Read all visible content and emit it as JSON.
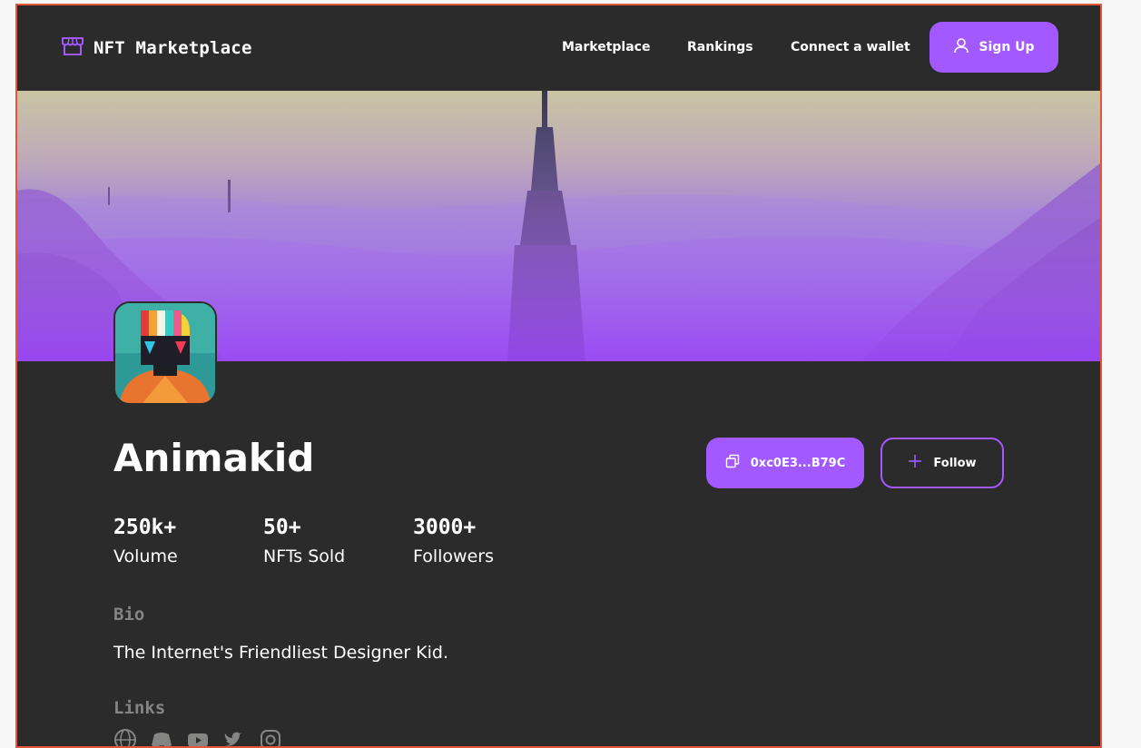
{
  "brand": {
    "name": "NFT Marketplace",
    "icon": "storefront-icon",
    "accent": "#a259ff"
  },
  "nav": {
    "links": [
      "Marketplace",
      "Rankings",
      "Connect a wallet"
    ],
    "signup_label": "Sign Up",
    "signup_icon": "user-icon"
  },
  "profile": {
    "name": "Animakid",
    "wallet_label": "0xc0E3...B79C",
    "wallet_icon": "copy-icon",
    "follow_label": "Follow",
    "follow_icon": "plus-icon",
    "stats": [
      {
        "value": "250k+",
        "label": "Volume"
      },
      {
        "value": "50+",
        "label": "NFTs Sold"
      },
      {
        "value": "3000+",
        "label": "Followers"
      }
    ],
    "bio_title": "Bio",
    "bio": "The Internet's Friendliest Designer Kid.",
    "links_title": "Links",
    "link_icons": [
      "globe-icon",
      "discord-icon",
      "youtube-icon",
      "twitter-icon",
      "instagram-icon"
    ]
  },
  "colors": {
    "background": "#2b2b2b",
    "accent": "#a259ff",
    "muted": "#858584",
    "frame_border": "#e4563a"
  }
}
